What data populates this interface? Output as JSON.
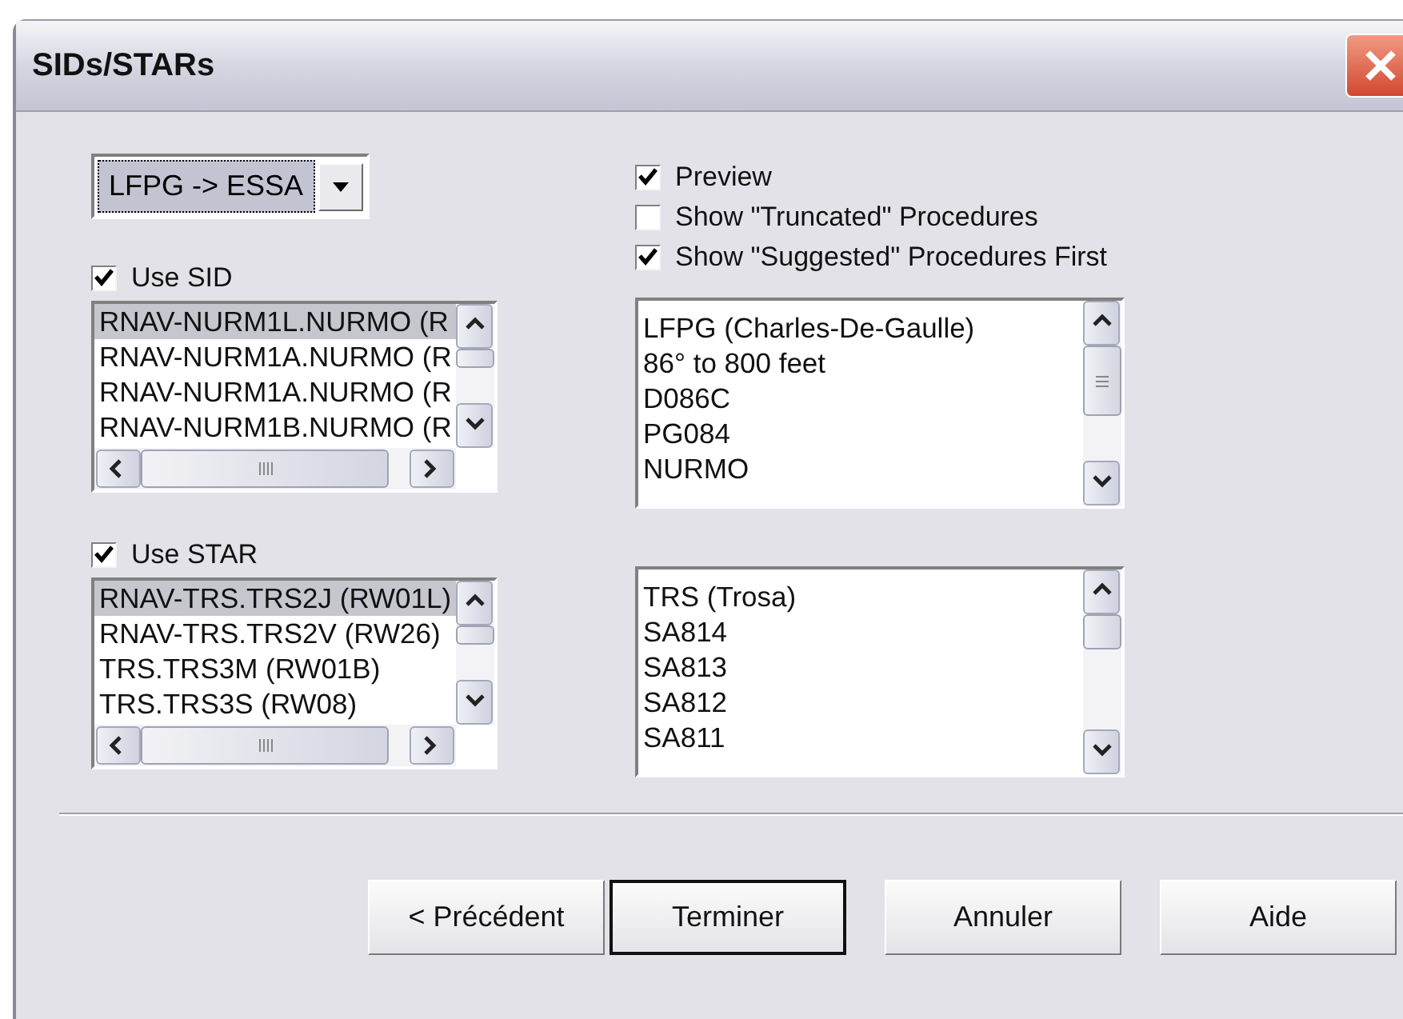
{
  "window": {
    "title": "SIDs/STARs"
  },
  "route_combo": {
    "value": "LFPG -> ESSA"
  },
  "options": [
    {
      "label": "Preview",
      "checked": true
    },
    {
      "label": "Show \"Truncated\" Procedures",
      "checked": false
    },
    {
      "label": "Show \"Suggested\" Procedures First",
      "checked": true
    }
  ],
  "sid": {
    "label": "Use SID",
    "checked": true,
    "items": [
      {
        "text": "RNAV-NURM1L.NURMO (R",
        "selected": true
      },
      {
        "text": "RNAV-NURM1A.NURMO (R",
        "selected": false
      },
      {
        "text": "RNAV-NURM1A.NURMO (R",
        "selected": false
      },
      {
        "text": "RNAV-NURM1B.NURMO (R",
        "selected": false
      }
    ]
  },
  "sid_preview": {
    "items": [
      "LFPG (Charles-De-Gaulle)",
      "86° to 800 feet",
      "D086C",
      "PG084",
      "NURMO"
    ]
  },
  "star": {
    "label": "Use STAR",
    "checked": true,
    "items": [
      {
        "text": "RNAV-TRS.TRS2J (RW01L)",
        "selected": true
      },
      {
        "text": "RNAV-TRS.TRS2V (RW26)",
        "selected": false
      },
      {
        "text": "TRS.TRS3M (RW01B)",
        "selected": false
      },
      {
        "text": "TRS.TRS3S (RW08)",
        "selected": false
      }
    ]
  },
  "star_preview": {
    "items": [
      "TRS (Trosa)",
      "SA814",
      "SA813",
      "SA812",
      "SA811"
    ]
  },
  "buttons": [
    {
      "label": "< Précédent",
      "default": false
    },
    {
      "label": "Terminer",
      "default": true
    },
    {
      "label": "Annuler",
      "default": false
    },
    {
      "label": "Aide",
      "default": false
    }
  ]
}
